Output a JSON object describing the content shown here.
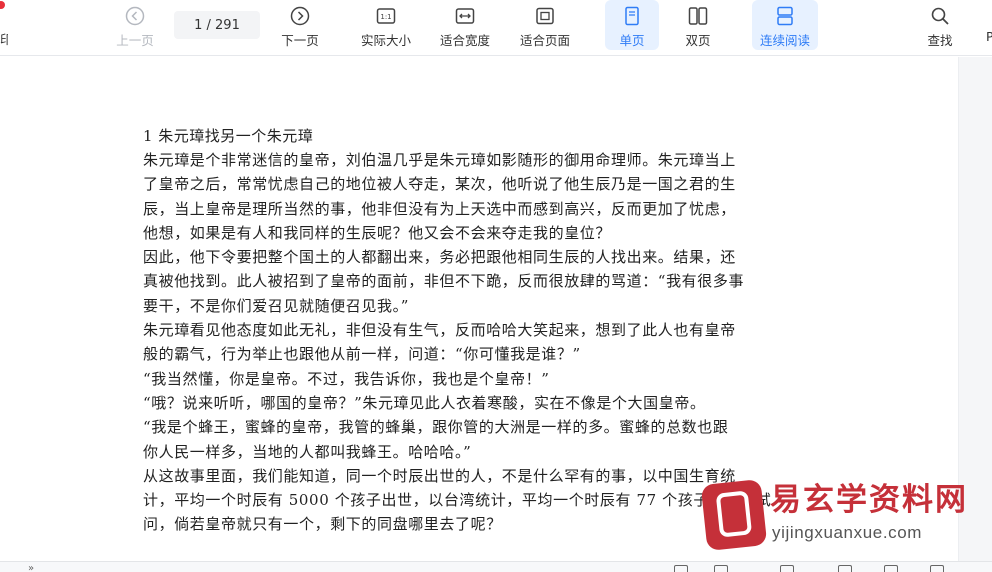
{
  "toolbar": {
    "prev": {
      "label": "上一页",
      "icon": "arrow-left-circle-icon"
    },
    "page": {
      "current": "1",
      "separator": "/",
      "total": "291",
      "display": "1 / 291"
    },
    "next": {
      "label": "下一页",
      "icon": "arrow-right-circle-icon"
    },
    "actual_size": {
      "label": "实际大小",
      "icon": "actual-size-icon",
      "icon_text": "1:1"
    },
    "fit_width": {
      "label": "适合宽度",
      "icon": "fit-width-icon"
    },
    "fit_page": {
      "label": "适合页面",
      "icon": "fit-page-icon"
    },
    "single_page": {
      "label": "单页",
      "icon": "single-page-icon",
      "active": true
    },
    "double_page": {
      "label": "双页",
      "icon": "double-page-icon"
    },
    "continuous": {
      "label": "连续阅读",
      "icon": "continuous-read-icon",
      "active": true
    },
    "search": {
      "label": "查找",
      "icon": "search-icon"
    },
    "left_cut_label": "印",
    "right_cut_label": "P"
  },
  "colors": {
    "accent": "#2f7cf6",
    "active_bg": "#e7f1ff",
    "disabled": "#b4b8bf",
    "watermark_red": "#c53039",
    "dot_red": "#e8303a"
  },
  "document": {
    "title": "1 朱元璋找另一个朱元璋",
    "lines": [
      "朱元璋是个非常迷信的皇帝，刘伯温几乎是朱元璋如影随形的御用命理师。朱元璋当上",
      "了皇帝之后，常常忧虑自己的地位被人夺走，某次，他听说了他生辰乃是一国之君的生",
      "辰，当上皇帝是理所当然的事，他非但没有为上天选中而感到高兴，反而更加了忧虑，",
      "他想，如果是有人和我同样的生辰呢？他又会不会来夺走我的皇位？",
      "因此，他下令要把整个国土的人都翻出来，务必把跟他相同生辰的人找出来。结果，还",
      "真被他找到。此人被招到了皇帝的面前，非但不下跪，反而很放肆的骂道：“我有很多事",
      "要干，不是你们爱召见就随便召见我。”",
      "朱元璋看见他态度如此无礼，非但没有生气，反而哈哈大笑起来，想到了此人也有皇帝",
      "般的霸气，行为举止也跟他从前一样，问道：“你可懂我是谁？”",
      "“我当然懂，你是皇帝。不过，我告诉你，我也是个皇帝！”",
      "“哦？说来听听，哪国的皇帝？”朱元璋见此人衣着寒酸，实在不像是个大国皇帝。",
      "“我是个蜂王，蜜蜂的皇帝，我管的蜂巢，跟你管的大洲是一样的多。蜜蜂的总数也跟",
      "你人民一样多，当地的人都叫我蜂王。哈哈哈。”",
      "从这故事里面，我们能知道，同一个时辰出世的人，不是什么罕有的事，以中国生育统",
      "计，平均一个时辰有 5000 个孩子出世，以台湾统计，平均一个时辰有 77 个孩子出世，试",
      "问，倘若皇帝就只有一个，剩下的同盘哪里去了呢？"
    ]
  },
  "watermark": {
    "main": "易玄学资料网",
    "sub": "yijingxuanxue.com"
  }
}
